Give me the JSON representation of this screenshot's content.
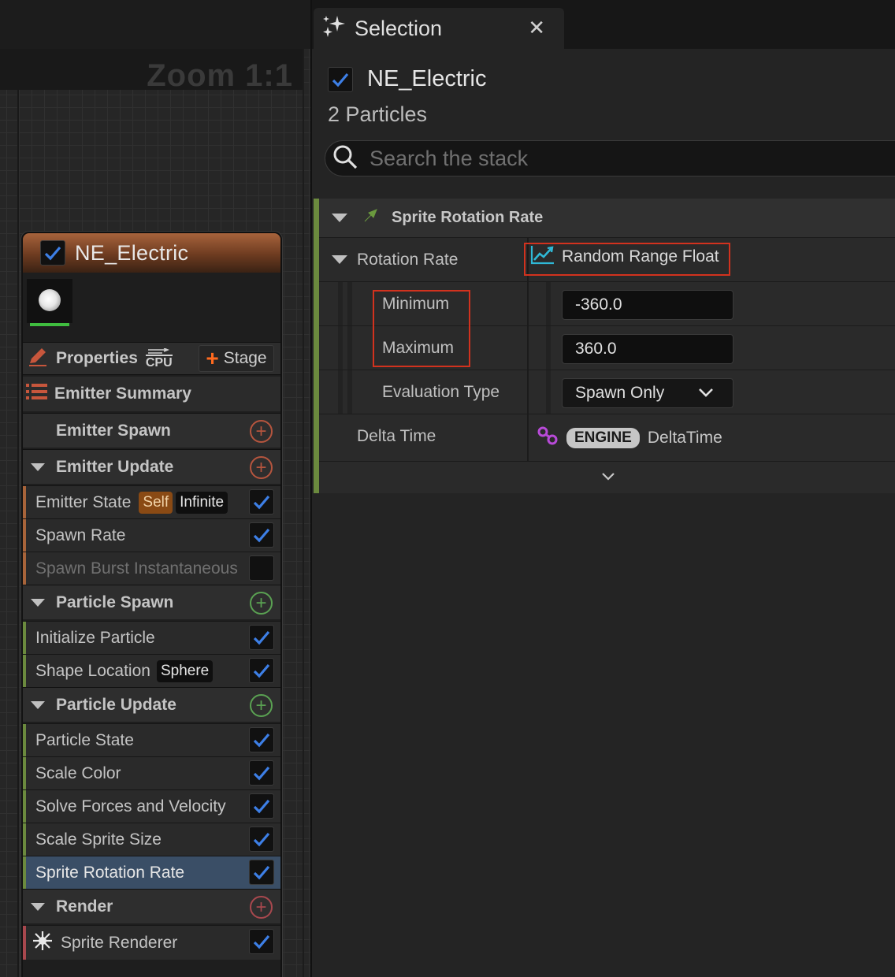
{
  "graph": {
    "zoom_label": "Zoom 1:1"
  },
  "node": {
    "title": "NE_Electric",
    "properties_label": "Properties",
    "cpu_label": "CPU",
    "stage_label": "Stage",
    "emitter_summary_label": "Emitter Summary",
    "groups": {
      "emitter_spawn": "Emitter Spawn",
      "emitter_update": "Emitter Update",
      "particle_spawn": "Particle Spawn",
      "particle_update": "Particle Update",
      "render": "Render"
    },
    "modules": {
      "emitter_state": "Emitter State",
      "emitter_state_tag1": "Self",
      "emitter_state_tag2": "Infinite",
      "spawn_rate": "Spawn Rate",
      "spawn_burst": "Spawn Burst Instantaneous",
      "initialize_particle": "Initialize Particle",
      "shape_location": "Shape Location",
      "shape_location_tag": "Sphere",
      "particle_state": "Particle State",
      "scale_color": "Scale Color",
      "solve_forces": "Solve Forces and Velocity",
      "scale_sprite_size": "Scale Sprite Size",
      "sprite_rotation_rate": "Sprite Rotation Rate",
      "sprite_renderer": "Sprite Renderer"
    }
  },
  "panel": {
    "tab_title": "Selection",
    "emitter_title": "NE_Electric",
    "particles_count": "2 Particles",
    "search_placeholder": "Search the stack",
    "section_title": "Sprite Rotation Rate",
    "rotation_rate_label": "Rotation Rate",
    "rotation_rate_value": "Random Range Float",
    "minimum_label": "Minimum",
    "minimum_value": "-360.0",
    "maximum_label": "Maximum",
    "maximum_value": "360.0",
    "evaluation_type_label": "Evaluation Type",
    "evaluation_type_value": "Spawn Only",
    "delta_time_label": "Delta Time",
    "delta_time_tag": "ENGINE",
    "delta_time_value": "DeltaTime"
  },
  "colors": {
    "checkbox_check": "#3d7fe6",
    "highlight_border": "#d2321e",
    "emitter_header": "#a7633c",
    "selected_row": "#3a4e66",
    "group_accent_green": "#6b8a3e"
  }
}
